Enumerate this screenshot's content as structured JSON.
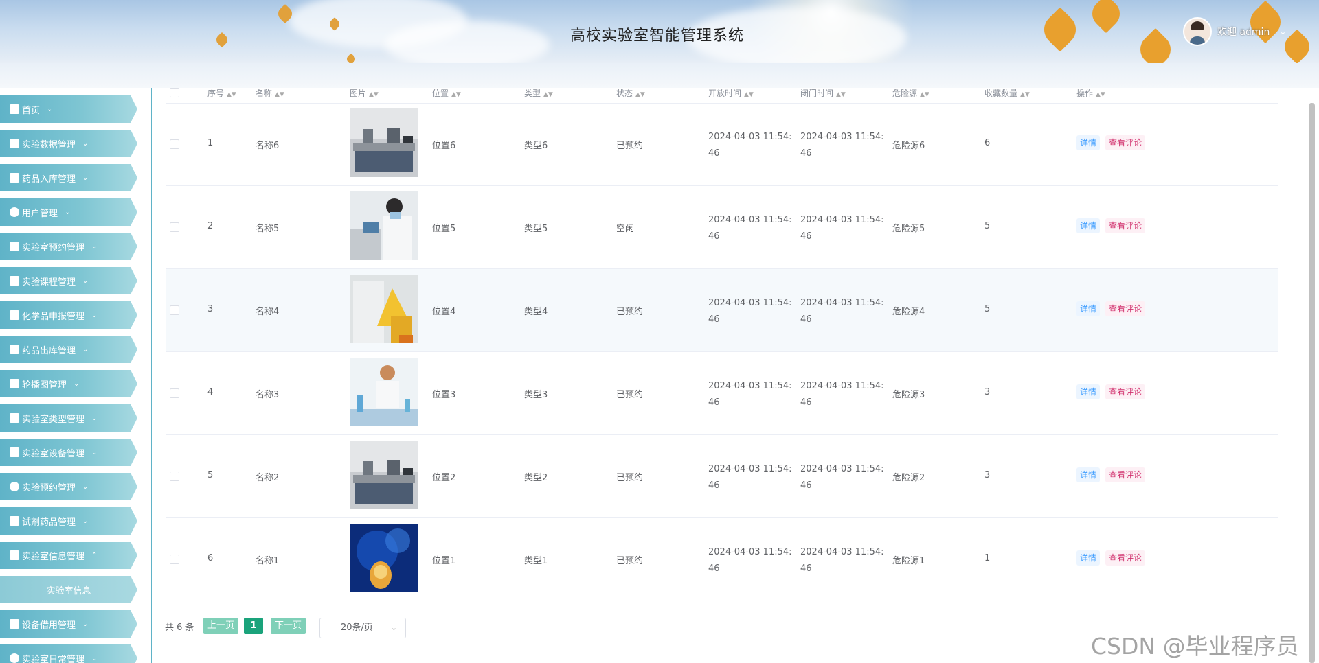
{
  "header": {
    "title": "高校实验室智能管理系统",
    "user": {
      "name": "欢迎 admin"
    }
  },
  "sidebar": {
    "items": [
      {
        "label": "首页",
        "icon": "home-icon"
      },
      {
        "label": "实验数据管理",
        "icon": "data-icon"
      },
      {
        "label": "药品入库管理",
        "icon": "inbox-icon"
      },
      {
        "label": "用户管理",
        "icon": "user-icon"
      },
      {
        "label": "实验室预约管理",
        "icon": "grid-icon"
      },
      {
        "label": "实验课程管理",
        "icon": "list-icon"
      },
      {
        "label": "化学品申报管理",
        "icon": "table-icon"
      },
      {
        "label": "药品出库管理",
        "icon": "box-icon"
      },
      {
        "label": "轮播图管理",
        "icon": "image-icon"
      },
      {
        "label": "实验室类型管理",
        "icon": "columns-icon"
      },
      {
        "label": "实验室设备管理",
        "icon": "device-icon"
      },
      {
        "label": "实验预约管理",
        "icon": "circle-icon"
      },
      {
        "label": "试剂药品管理",
        "icon": "gift-icon"
      },
      {
        "label": "实验室信息管理",
        "icon": "info-icon",
        "expanded": true
      },
      {
        "label": "实验室信息",
        "sub": true
      },
      {
        "label": "设备借用管理",
        "icon": "crop-icon"
      },
      {
        "label": "实验室日常管理",
        "icon": "drop-icon"
      }
    ]
  },
  "table": {
    "columns": [
      "序号",
      "名称",
      "图片",
      "位置",
      "类型",
      "状态",
      "开放时间",
      "闭门时间",
      "危险源",
      "收藏数量",
      "操作"
    ],
    "rows": [
      {
        "index": "1",
        "name": "名称6",
        "location": "位置6",
        "type": "类型6",
        "status": "已预约",
        "open_time": "2024-04-03 11:54:46",
        "close_time": "2024-04-03 11:54:46",
        "hazard": "危险源6",
        "favorites": "6",
        "image": "lab-room-image"
      },
      {
        "index": "2",
        "name": "名称5",
        "location": "位置5",
        "type": "类型5",
        "status": "空闲",
        "open_time": "2024-04-03 11:54:46",
        "close_time": "2024-04-03 11:54:46",
        "hazard": "危险源5",
        "favorites": "5",
        "image": "researcher-image"
      },
      {
        "index": "3",
        "name": "名称4",
        "location": "位置4",
        "type": "类型4",
        "status": "已预约",
        "open_time": "2024-04-03 11:54:46",
        "close_time": "2024-04-03 11:54:46",
        "hazard": "危险源4",
        "favorites": "5",
        "image": "hazmat-image"
      },
      {
        "index": "4",
        "name": "名称3",
        "location": "位置3",
        "type": "类型3",
        "status": "已预约",
        "open_time": "2024-04-03 11:54:46",
        "close_time": "2024-04-03 11:54:46",
        "hazard": "危险源3",
        "favorites": "3",
        "image": "scientist-image"
      },
      {
        "index": "5",
        "name": "名称2",
        "location": "位置2",
        "type": "类型2",
        "status": "已预约",
        "open_time": "2024-04-03 11:54:46",
        "close_time": "2024-04-03 11:54:46",
        "hazard": "危险源2",
        "favorites": "3",
        "image": "lab-room-image"
      },
      {
        "index": "6",
        "name": "名称1",
        "location": "位置1",
        "type": "类型1",
        "status": "已预约",
        "open_time": "2024-04-03 11:54:46",
        "close_time": "2024-04-03 11:54:46",
        "hazard": "危险源1",
        "favorites": "1",
        "image": "chemistry-image"
      }
    ],
    "actions": {
      "detail": "详情",
      "comment": "查看评论"
    }
  },
  "pagination": {
    "total": "共 6 条",
    "prev": "上一页",
    "current": "1",
    "next": "下一页",
    "page_size": "20条/页"
  },
  "watermark": "CSDN @毕业程序员",
  "colors": {
    "sidebar": "#7fc6d3",
    "active_page": "#1aa37b",
    "page_btn": "#7fd0b8",
    "detail": "#409eff",
    "comment": "#d1306d"
  }
}
